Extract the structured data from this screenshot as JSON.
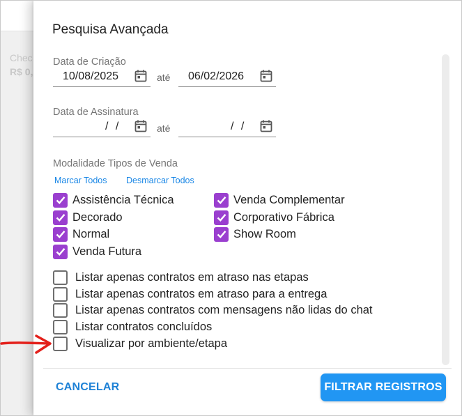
{
  "background": {
    "card_title": "Chec",
    "card_value": "R$ 0,"
  },
  "dialog": {
    "title": "Pesquisa Avançada",
    "creation_date": {
      "label": "Data de Criação",
      "from": "10/08/2025",
      "separator": "até",
      "to": "06/02/2026"
    },
    "signature_date": {
      "label": "Data de Assinatura",
      "from": "/ /",
      "separator": "até",
      "to": "/ /"
    },
    "sale_types": {
      "label": "Modalidade Tipos de Venda",
      "select_all": "Marcar Todos",
      "deselect_all": "Desmarcar Todos",
      "items": [
        {
          "label": "Assistência Técnica",
          "checked": true
        },
        {
          "label": "Venda Complementar",
          "checked": true
        },
        {
          "label": "Decorado",
          "checked": true
        },
        {
          "label": "Corporativo Fábrica",
          "checked": true
        },
        {
          "label": "Normal",
          "checked": true
        },
        {
          "label": "Show Room",
          "checked": true
        },
        {
          "label": "Venda Futura",
          "checked": true
        }
      ]
    },
    "options": [
      {
        "label": "Listar apenas contratos em atraso nas etapas",
        "checked": false
      },
      {
        "label": "Listar apenas contratos em atraso para a entrega",
        "checked": false
      },
      {
        "label": "Listar apenas contratos com mensagens não lidas do chat",
        "checked": false
      },
      {
        "label": "Listar contratos concluídos",
        "checked": false
      },
      {
        "label": "Visualizar por ambiente/etapa",
        "checked": false
      }
    ],
    "cancel_label": "CANCELAR",
    "filter_label": "FILTRAR REGISTROS"
  },
  "colors": {
    "accent": "#2196f3",
    "checkbox": "#9a3fcf",
    "annotation_arrow": "#e3201b"
  },
  "icons": {
    "date_picker": "calendar-icon",
    "checkmark": "check-icon",
    "annotation": "red-arrow-icon"
  }
}
